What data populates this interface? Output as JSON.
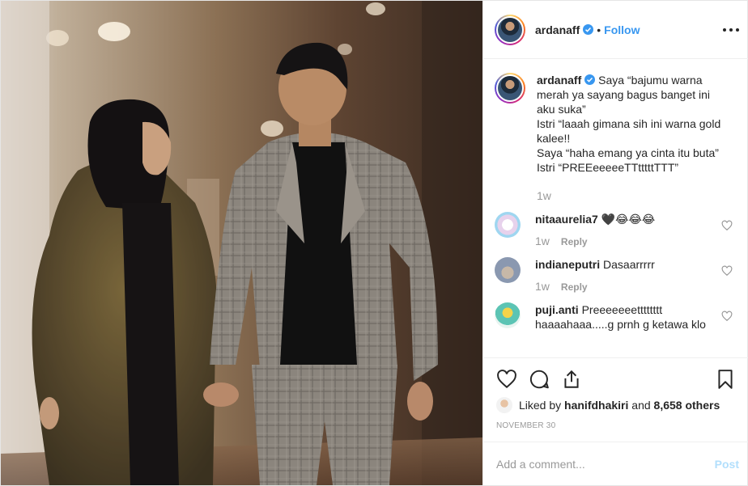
{
  "header": {
    "username": "ardanaff",
    "dot": "•",
    "follow_label": "Follow"
  },
  "caption": {
    "username": "ardanaff",
    "lines": [
      "Saya “bajumu warna merah ya sayang bagus banget ini aku suka”",
      "Istri “laaah gimana sih ini warna gold kalee!!",
      "Saya “haha emang ya cinta itu buta”",
      "Istri “PREEeeeeeTTtttttTTT”"
    ],
    "time": "1w"
  },
  "comments": [
    {
      "username": "nitaaurelia7",
      "text": "🖤😂😂😂",
      "time": "1w",
      "reply": "Reply"
    },
    {
      "username": "indianeputri",
      "text": "Dasaarrrrr",
      "time": "1w",
      "reply": "Reply"
    },
    {
      "username": "puji.anti",
      "text": "Preeeeeeetttttttt haaaahaaa.....g prnh g ketawa klo",
      "time": "",
      "reply": ""
    }
  ],
  "likes": {
    "prefix": "Liked by",
    "user": "hanifdhakiri",
    "middle": "and",
    "count": "8,658 others"
  },
  "date": "NOVEMBER 30",
  "add_comment": {
    "placeholder": "Add a comment...",
    "post_label": "Post"
  },
  "icons": [
    "verified-icon",
    "more-options-icon",
    "like-icon",
    "comment-icon",
    "share-icon",
    "bookmark-icon",
    "heart-icon"
  ],
  "colors": {
    "accent": "#3897f0",
    "post_disabled": "#b2dffc",
    "muted": "#999999"
  }
}
